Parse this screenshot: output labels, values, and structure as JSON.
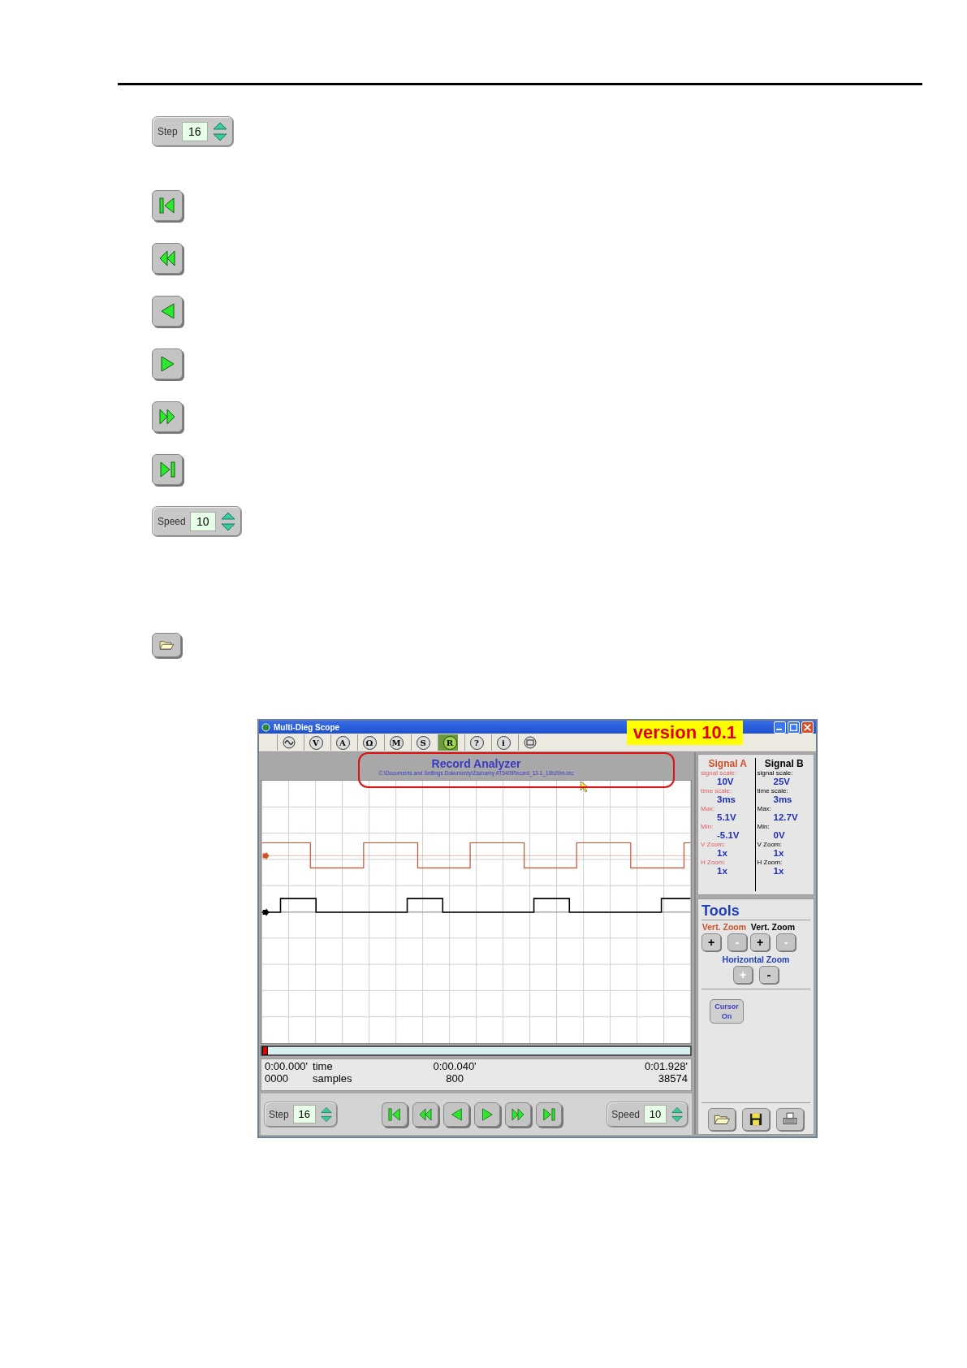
{
  "legend": {
    "step": {
      "label": "Step",
      "value": "16"
    },
    "speed": {
      "label": "Speed",
      "value": "10"
    }
  },
  "app_window": {
    "title": "Multi-Dieg Scope",
    "toolbar": [
      {
        "kind": "wave",
        "selected": false
      },
      {
        "kind": "letter",
        "glyph": "V",
        "selected": false
      },
      {
        "kind": "letter",
        "glyph": "A",
        "selected": false
      },
      {
        "kind": "letter",
        "glyph": "Ω",
        "selected": false
      },
      {
        "kind": "letter",
        "glyph": "M",
        "selected": false
      },
      {
        "kind": "letter",
        "glyph": "S",
        "selected": false
      },
      {
        "kind": "letter",
        "glyph": "R",
        "selected": true
      },
      {
        "kind": "letter",
        "glyph": "?",
        "selected": false
      },
      {
        "kind": "letter",
        "glyph": "i",
        "selected": false
      },
      {
        "kind": "screen",
        "selected": false
      }
    ],
    "version_banner": "version 10.1",
    "header": {
      "title": "Record Analyzer",
      "path": "C:\\Documents and Settings Dokumenty\\Záznamy AT540\\Record_13-1_10h20m.rec"
    },
    "signals": [
      {
        "name": "Signal A",
        "color": "#d0502a",
        "fields": [
          {
            "label": "signal scale:",
            "value": "10V"
          },
          {
            "label": "time scale:",
            "value": "3ms"
          },
          {
            "label": "Max:",
            "value": "5.1V"
          },
          {
            "label": "Min:",
            "value": "-5.1V"
          },
          {
            "label": "V Zoom:",
            "value": "1x"
          },
          {
            "label": "H Zoom:",
            "value": "1x"
          }
        ]
      },
      {
        "name": "Signal B",
        "color": "#000000",
        "fields": [
          {
            "label": "signal scale:",
            "value": "25V"
          },
          {
            "label": "time scale:",
            "value": "3ms"
          },
          {
            "label": "Max:",
            "value": "12.7V"
          },
          {
            "label": "Min:",
            "value": "0V"
          },
          {
            "label": "V Zoom:",
            "value": "1x"
          },
          {
            "label": "H Zoom:",
            "value": "1x"
          }
        ]
      }
    ],
    "tools": {
      "title": "Tools",
      "vert_zoom": [
        {
          "label": "Vert. Zoom",
          "buttons": [
            {
              "glyph": "+",
              "disabled": false
            },
            {
              "glyph": "-",
              "disabled": true
            }
          ]
        },
        {
          "label": "Vert. Zoom",
          "buttons": [
            {
              "glyph": "+",
              "disabled": false
            },
            {
              "glyph": "-",
              "disabled": true
            }
          ]
        }
      ],
      "horizontal_zoom": {
        "label": "Horizontal Zoom",
        "buttons": [
          {
            "glyph": "+",
            "disabled": true
          },
          {
            "glyph": "-",
            "disabled": false
          }
        ]
      },
      "cursor_button": "Cursor On"
    },
    "position_slider": {
      "level": 0
    },
    "readout": {
      "labels": [
        "time",
        "samples"
      ],
      "start": [
        "0:00.000'",
        "0000"
      ],
      "middle": [
        "0:00.040'",
        "800"
      ],
      "end": [
        "0:01.928'",
        "38574"
      ]
    },
    "controls": {
      "step": {
        "label": "Step",
        "value": "16"
      },
      "speed": {
        "label": "Speed",
        "value": "10"
      }
    }
  }
}
